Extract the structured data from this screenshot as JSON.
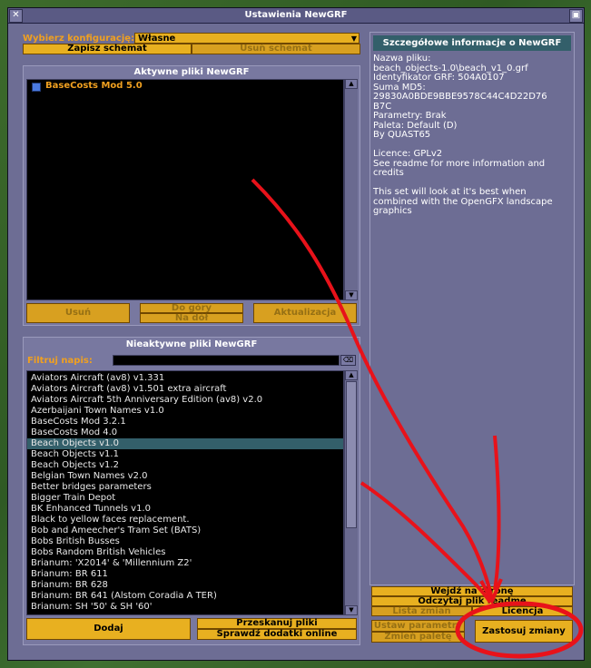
{
  "window": {
    "title": "Ustawienia NewGRF",
    "close_glyph": "✕",
    "sticky_glyph": "▣"
  },
  "config": {
    "label": "Wybierz konfigurację:",
    "value": "Własne",
    "save_label": "Zapisz schemat",
    "delete_label": "Usuń schemat"
  },
  "active": {
    "header": "Aktywne pliki NewGRF",
    "items": [
      {
        "label": "BaseCosts Mod 5.0"
      }
    ],
    "remove_label": "Usuń",
    "up_label": "Do góry",
    "down_label": "Na dół",
    "update_label": "Aktualizacja"
  },
  "inactive": {
    "header": "Nieaktywne pliki NewGRF",
    "filter_label": "Filtruj napis:",
    "filter_value": "",
    "clear_glyph": "⌫",
    "items": [
      "Aviators Aircraft (av8) v1.331",
      "Aviators Aircraft (av8) v1.501 extra aircraft",
      "Aviators Aircraft 5th Anniversary Edition (av8) v2.0",
      "Azerbaijani Town Names v1.0",
      "BaseCosts Mod 3.2.1",
      "BaseCosts Mod 4.0",
      "Beach Objects v1.0",
      "Beach Objects v1.1",
      "Beach Objects v1.2",
      "Belgian Town Names v2.0",
      "Better bridges parameters",
      "Bigger Train Depot",
      "BK Enhanced Tunnels v1.0",
      "Black to yellow faces replacement.",
      "Bob and Ameecher's Tram Set (BATS)",
      "Bobs British Busses",
      "Bobs Random British Vehicles",
      "Brianum: 'X2014' & 'Millennium Z2'",
      "Brianum: BR 611",
      "Brianum: BR 628",
      "Brianum: BR 641 (Alstom Coradia A TER)",
      "Brianum: SH '50' & SH '60'"
    ],
    "selected_index": 6,
    "add_label": "Dodaj",
    "rescan_label": "Przeskanuj pliki",
    "online_label": "Sprawdź dodatki online"
  },
  "details": {
    "header": "Szczegółowe informacje o NewGRF",
    "lines": [
      "Nazwa pliku:",
      "beach_objects-1.0\\beach_v1_0.grf",
      "Identyfikator GRF: 504A0107",
      "Suma MD5:",
      "29830A0BDE9BBE9578C44C4D22D76",
      "B7C",
      "Parametry: Brak",
      "Paleta: Default (D)",
      "By QUAST65",
      "",
      "Licence: GPLv2",
      "See readme for more information and",
      "credits",
      "",
      "This set will look at it's best when",
      "combined with the OpenGFX landscape",
      "graphics"
    ]
  },
  "right_buttons": {
    "website_label": "Wejdź na stronę",
    "readme_label": "Odczytaj plik readme",
    "changelog_label": "Lista zmian",
    "license_label": "Licencja",
    "params_label": "Ustaw parametry",
    "palette_label": "Zmień paletę",
    "apply_label": "Zastosuj zmiany"
  },
  "colors": {
    "button": "#e8b020",
    "panel": "#6d6d94",
    "selection": "#335f6a",
    "annotation": "#e8121a"
  }
}
